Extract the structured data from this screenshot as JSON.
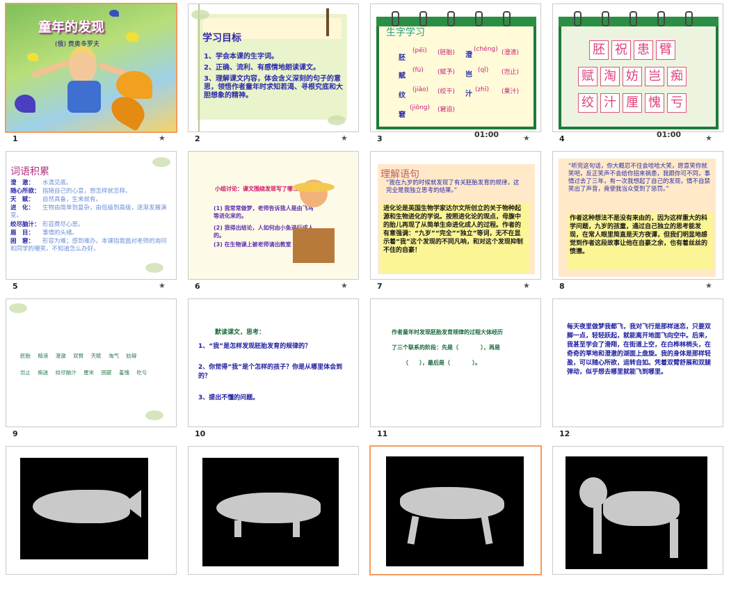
{
  "slides": [
    {
      "number": "1",
      "title": "童年的发现",
      "author": "(俄) 费奥多罗夫"
    },
    {
      "number": "2",
      "heading": "学习目标",
      "items": [
        "1、学会本课的生字词。",
        "2、正确、流利、有感情地朗读课文。",
        "3、理解课文内容，体会含义深刻的句子的意思，领悟作者童年时求知若渴、寻根究底和大胆想象的精神。"
      ]
    },
    {
      "number": "3",
      "heading": "生字学习",
      "timer": "01:00",
      "left_chars": [
        "胚",
        "赋",
        "纹",
        "窘"
      ],
      "left_pinyin": [
        "(pēi)",
        "(fù)",
        "(jiǎo)",
        "(jiǒng)"
      ],
      "left_words": [
        "(胚胎)",
        "(赋予)",
        "(绞干)",
        "(窘迫)"
      ],
      "right_chars": [
        "澄",
        "岂",
        "汁"
      ],
      "right_pinyin": [
        "(chéng)",
        "(qǐ)",
        "(zhī)"
      ],
      "right_words": [
        "(澄清)",
        "(岂止)",
        "(果汁)"
      ]
    },
    {
      "number": "4",
      "timer": "01:00",
      "rows": [
        [
          "胚",
          "祝",
          "患",
          "臂"
        ],
        [
          "赋",
          "淘",
          "妨",
          "岂",
          "痴"
        ],
        [
          "绞",
          "汁",
          "厘",
          "愧",
          "亏"
        ]
      ]
    },
    {
      "number": "5",
      "heading": "词语积累",
      "entries": [
        {
          "term": "澄　澈：",
          "def": "水清见底。"
        },
        {
          "term": "随心所欲：",
          "def": "指随自己的心意，想怎样就怎样。"
        },
        {
          "term": "天　赋：",
          "def": "自然具备，生来就有。"
        },
        {
          "term": "进　化：",
          "def": "生物由简单到复杂，由低级到高级，逐渐发展演变。"
        },
        {
          "term": "绞尽脑汁：",
          "def": "形容费尽心思。"
        },
        {
          "term": "眉　目：",
          "def": "事情的头绪。"
        },
        {
          "term": "困　窘：",
          "def": "形容为难；感到难办。本课指我面对老师的询问和同学的嘲笑，不知道怎么办好。"
        }
      ]
    },
    {
      "number": "6",
      "prompt": "小组讨论：课文围绕发现写了哪三件事？",
      "items": [
        "(1) 我常常做梦，老师告诉我人是由飞鸟等进化来的。",
        "(2) 我得出结论，人如何由小鱼进行成人的。",
        "(3) 在生物课上被老师请出教室"
      ]
    },
    {
      "number": "7",
      "heading": "理解语句",
      "quote": "“我在九岁的时候就发现了有关胚胎发育的规律，这完全是我独立思考的结果。”",
      "explain": "进化论是英国生物学家达尔文所创立的关于物种起源和生物进化的学说。按照进化论的观点，母腹中的胎儿再现了从简单生命进化成人的过程。作者的有意强调：“九岁”“完全”“独立”等词，无不在显示着“我”这个发现的不同凡响，和对这个发现抑制不住的自豪！"
    },
    {
      "number": "8",
      "quote": "“听完这句话，你大概忍不住会哈哈大笑，愿意笑你就笑吧，反正笑声不会给你招来祸患，我跟你可不同，事情过去了三年，有一次我想起了自己的发现，情不自禁笑出了声音，竟使我当众受到了惩罚。”",
      "explain": "作者这种想法不是没有来由的，因为这样重大的科学问题，九岁的孩童，通过自己独立的思考能发现，在常人眼里简直是天方夜谭，但我们明显地感觉到作者这段故事让他在自豪之余，也有着丝丝的愤懑。"
    },
    {
      "number": "9",
      "row1": [
        "胚胎",
        "精液",
        "澄澈",
        "双臂",
        "天赋",
        "淘气",
        "妨碍"
      ],
      "row2": [
        "岂止",
        "痴迷",
        "绞尽脑汁",
        "厘米",
        "困窘",
        "羞愧",
        "吃亏"
      ]
    },
    {
      "number": "10",
      "lead": "默读课文，思考：",
      "items": [
        "1、“我”是怎样发现胚胎发育的规律的？",
        "2、你觉得“我”是个怎样的孩子？你是从哪里体会到的？",
        "3、提出不懂的问题。"
      ]
    },
    {
      "number": "11",
      "line1": "作者童年时发现胚胎发育规律的过程大体经历",
      "line2": "了三个联系的阶段：先是（　　　　），再是",
      "line3": "（　　），最后是（　　　　）。"
    },
    {
      "number": "12",
      "text": "每天夜里做梦我都飞，我对飞行是那样迷恋，只要双脚一点，轻轻跃起，就能离开地面飞向空中。后来，我甚至学会了滑翔，在街道上空，在白桦林梢头，在奇奇的草地和澄澈的湖面上盘旋。我的身体是那样轻盈，可以随心所欲，运转自如。凭着双臂舒展和双腿弹动，似乎想去哪里就能飞到哪里。"
    },
    {
      "number": "13"
    },
    {
      "number": "14"
    },
    {
      "number": "15"
    },
    {
      "number": "16"
    }
  ],
  "star_icon": "★",
  "colors": {
    "selection": "#f39a5d",
    "calendar": "#1f7a3a"
  }
}
